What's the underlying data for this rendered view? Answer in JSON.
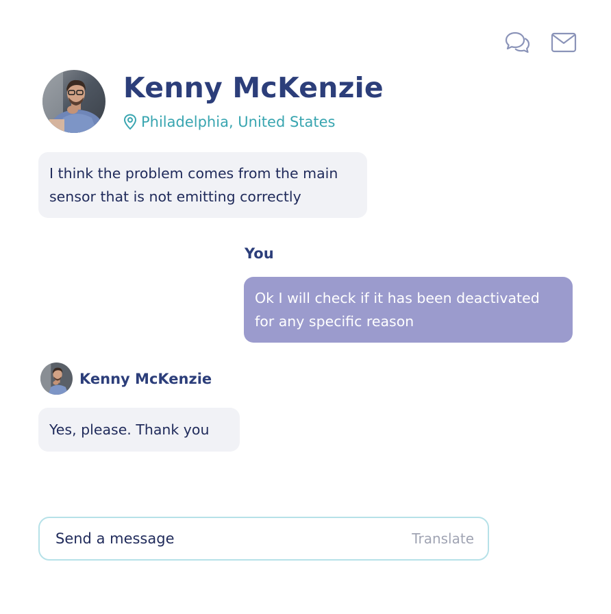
{
  "header_icons": [
    {
      "name": "chat-icon",
      "color": "#8a93b8"
    },
    {
      "name": "mail-icon",
      "color": "#8a93b8"
    }
  ],
  "contact": {
    "name": "Kenny McKenzie",
    "location": "Philadelphia, United States",
    "location_icon": "map-pin-icon"
  },
  "messages": [
    {
      "direction": "incoming",
      "text": "I think the problem comes from the main sensor that is not emitting correctly"
    },
    {
      "direction": "outgoing",
      "sender": "You",
      "text": "Ok I will check if it has been deactivated for any specific reason"
    },
    {
      "direction": "incoming",
      "sender": "Kenny McKenzie",
      "text": "Yes, please. Thank you"
    }
  ],
  "composer": {
    "placeholder": "Send a message",
    "translate_label": "Translate"
  },
  "colors": {
    "accent_name": "#2c3e7a",
    "location": "#38a5b0",
    "outgoing_bubble": "#9b9bcd",
    "incoming_bubble": "#f1f2f6",
    "composer_border": "#b6e1e8"
  }
}
